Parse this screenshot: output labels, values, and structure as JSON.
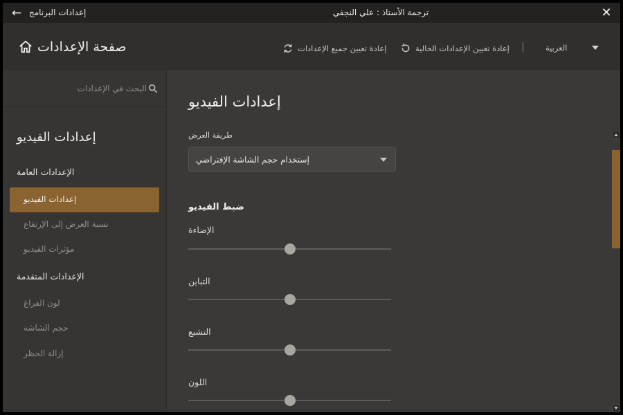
{
  "colors": {
    "accent": "#8a6331",
    "background": "#3a3938",
    "sidebar": "#363534",
    "titlebar": "#232220",
    "header": "#302f2d"
  },
  "titlebar": {
    "back_icon": "arrow-left-icon",
    "app_settings": "إعدادات البرنامج",
    "translation_credit": "ترجمة الأستاذ : علي النجفي",
    "close_icon": "close-icon"
  },
  "header": {
    "home_icon": "home-icon",
    "home_title": "صفحة الإعدادات",
    "reset_all_label": "إعادة تعيين جميع الإعدادات",
    "reset_current_label": "إعادة تعيين الإعدادات الحالية",
    "language": "العربية"
  },
  "sidebar": {
    "search_placeholder": "البحث في الإعدادات",
    "heading": "إعدادات الفيديو",
    "groups": [
      {
        "title": "الإعدادات العامة",
        "items": [
          {
            "label": "إعدادات الفيديو",
            "active": true
          },
          {
            "label": "نسبة العرض إلى الإرتفاع",
            "active": false
          },
          {
            "label": "مؤثرات الفيديو",
            "active": false
          }
        ]
      },
      {
        "title": "الإعدادات المتقدمة",
        "items": [
          {
            "label": "لون الفراغ",
            "active": false
          },
          {
            "label": "حجم الشاشة",
            "active": false
          },
          {
            "label": "إزالة الحظر",
            "active": false
          }
        ]
      }
    ]
  },
  "main": {
    "title": "إعدادات الفيديو",
    "display_mode_label": "طريقة العرض",
    "display_mode_value": "إستخدام حجم الشاشة الإفتراضي",
    "section_title": "ضبط الفيديو",
    "sliders": [
      {
        "label": "الإضاءة",
        "value": 0.5
      },
      {
        "label": "التباين",
        "value": 0.5
      },
      {
        "label": "التشبع",
        "value": 0.5
      },
      {
        "label": "اللون",
        "value": 0.5
      }
    ]
  }
}
